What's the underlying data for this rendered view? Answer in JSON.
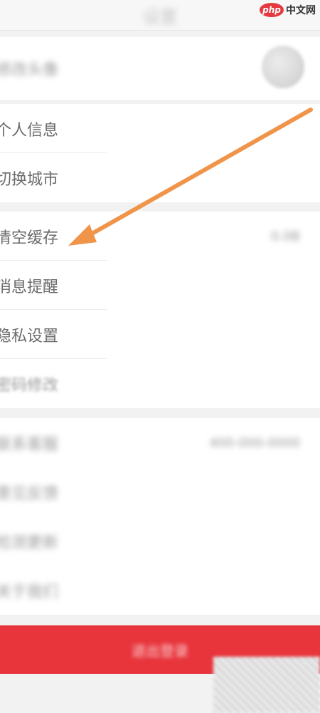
{
  "header": {
    "title": "设置"
  },
  "watermark": {
    "badge": "php",
    "text": "中文网"
  },
  "profile": {
    "avatar_label": "修改头像"
  },
  "group1": [
    {
      "label": "个人信息"
    },
    {
      "label": "切换城市"
    }
  ],
  "group2": [
    {
      "label": "清空缓存",
      "value": "0.0B"
    },
    {
      "label": "消息提醒"
    },
    {
      "label": "隐私设置"
    },
    {
      "label": "密码修改"
    }
  ],
  "group3": [
    {
      "label": "联系客服",
      "value": "400-000-0000"
    },
    {
      "label": "意见反馈"
    },
    {
      "label": "检测更新"
    },
    {
      "label": "关于我们"
    }
  ],
  "logout": {
    "label": "退出登录"
  },
  "colors": {
    "arrow": "#f0944a",
    "logout": "#e8353c",
    "watermark": "#e3393f"
  }
}
